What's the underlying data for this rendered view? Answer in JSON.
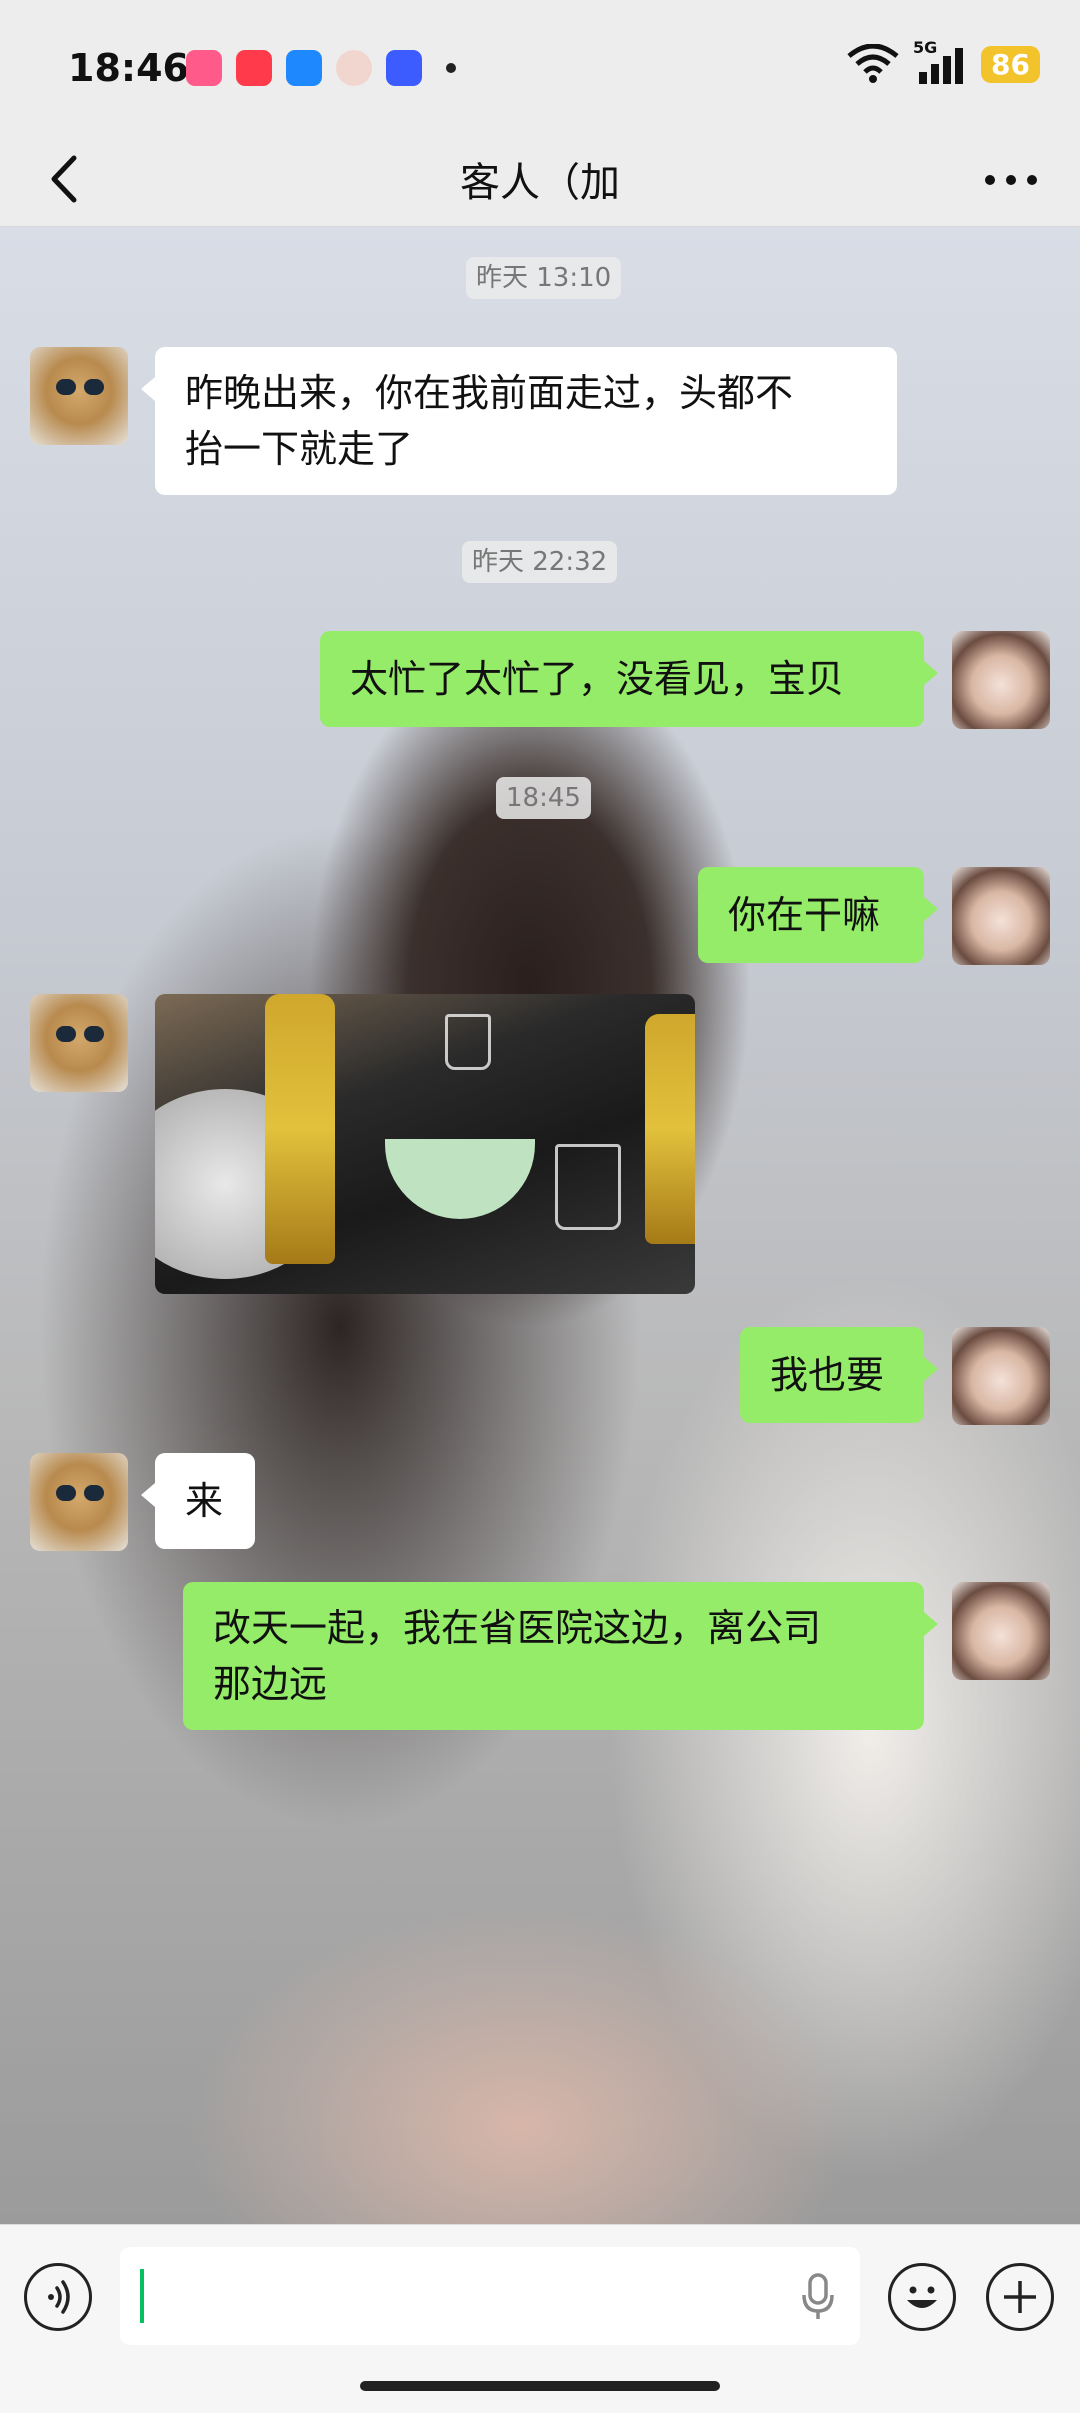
{
  "status_bar": {
    "time": "18:46",
    "network": "5G",
    "battery": "86"
  },
  "header": {
    "title": "客人（加"
  },
  "messages": [
    {
      "type": "timestamp",
      "text": "昨天 13:10"
    },
    {
      "type": "text",
      "from": "contact",
      "text": "昨晚出来，你在我前面走过，头都不抬一下就走了"
    },
    {
      "type": "timestamp",
      "text": "昨天 22:32"
    },
    {
      "type": "text",
      "from": "self",
      "text": "太忙了太忙了，没看见，宝贝"
    },
    {
      "type": "timestamp",
      "text": "18:45"
    },
    {
      "type": "text",
      "from": "self",
      "text": "你在干嘛"
    },
    {
      "type": "image",
      "from": "contact"
    },
    {
      "type": "text",
      "from": "self",
      "text": "我也要"
    },
    {
      "type": "text",
      "from": "contact",
      "text": "来"
    },
    {
      "type": "text",
      "from": "self",
      "text": "改天一起，我在省医院这边，离公司那边远"
    }
  ],
  "message_lines": {
    "m1_line1": "昨晚出来，你在我前面走过，头都不",
    "m1_line2": "抬一下就走了",
    "m9_line1": "改天一起，我在省医院这边，离公司",
    "m9_line2": "那边远"
  },
  "colors": {
    "outgoing_bubble": "#95ec69",
    "incoming_bubble": "#ffffff",
    "battery": "#f3c32b",
    "caret": "#07c160"
  }
}
